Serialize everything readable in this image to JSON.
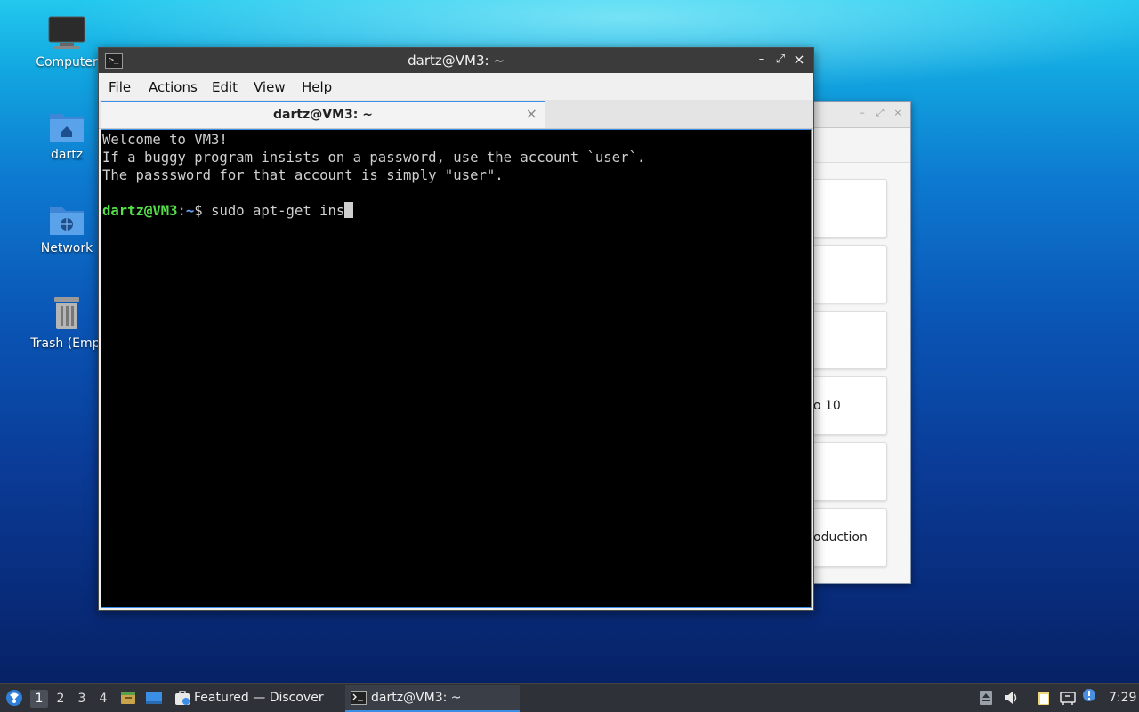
{
  "desktop": {
    "icons": [
      {
        "label": "Computer"
      },
      {
        "label": "dartz"
      },
      {
        "label": "Network"
      },
      {
        "label": "Trash (Empty)"
      }
    ]
  },
  "background_window": {
    "cards": [
      {
        "text": ""
      },
      {
        "text": ""
      },
      {
        "text": ""
      },
      {
        "text": "o 10"
      },
      {
        "text": ""
      },
      {
        "text": "oduction"
      }
    ]
  },
  "terminal": {
    "title": "dartz@VM3: ~",
    "controls": {
      "minimize": "–",
      "maximize": "⤢",
      "close": "×"
    },
    "menu": [
      "File",
      "Actions",
      "Edit",
      "View",
      "Help"
    ],
    "tab": {
      "label": "dartz@VM3: ~",
      "close": "×"
    },
    "lines": [
      "Welcome to VM3!",
      "If a buggy program insists on a password, use the account `user`.",
      "The passsword for that account is simply \"user\"."
    ],
    "prompt": {
      "user": "dartz@VM3",
      "sep": ":",
      "path": "~",
      "symbol": "$ ",
      "command": "sudo apt-get ins"
    }
  },
  "taskbar": {
    "workspaces": [
      "1",
      "2",
      "3",
      "4"
    ],
    "active_workspace": "1",
    "tasks": [
      {
        "label": "Featured — Discover",
        "active": false
      },
      {
        "label": "dartz@VM3: ~",
        "active": true
      }
    ],
    "clock": "7:29"
  },
  "colors": {
    "prompt_user": "#55e04a",
    "prompt_path": "#6aa6ff",
    "accent": "#3a8ee6",
    "terminal_bg": "#000000"
  }
}
